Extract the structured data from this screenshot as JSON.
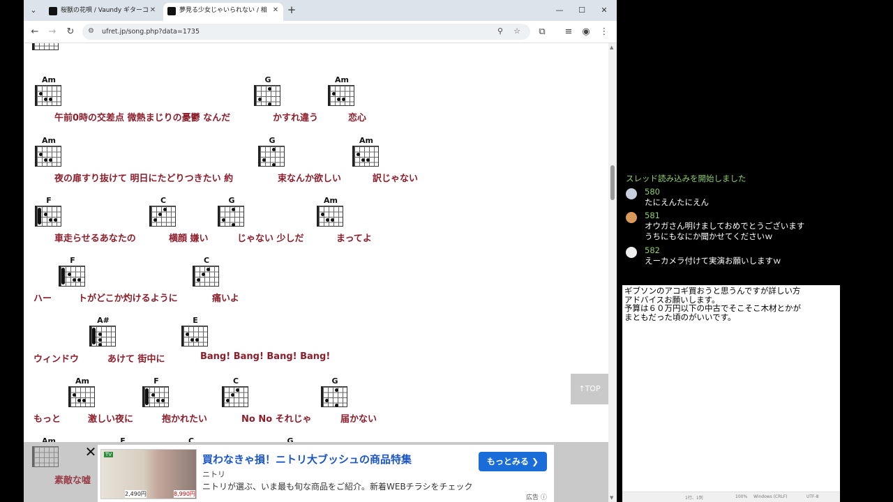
{
  "browser": {
    "tabs": [
      {
        "title": "桜獣の花唄 / Vaundy ギターコード/",
        "active": false
      },
      {
        "title": "夢見る少女じゃいられない / 相川七",
        "active": true
      }
    ],
    "url": "ufret.jp/song.php?data=1735"
  },
  "chart_rows": [
    {
      "chords": [
        {
          "name": "Am"
        },
        {
          "name": "G"
        },
        {
          "name": "Am"
        }
      ],
      "lyrics": [
        "午前0時の交差点 微熱まじりの憂鬱 なんだ",
        "かすれ違う",
        "恋心"
      ]
    },
    {
      "chords": [
        {
          "name": "Am"
        },
        {
          "name": "G"
        },
        {
          "name": "Am"
        }
      ],
      "lyrics": [
        "夜の扉すり抜けて 明日にたどりつきたい 約",
        "束なんか欲しい",
        "訳じゃない"
      ]
    },
    {
      "chords": [
        {
          "name": "F"
        },
        {
          "name": "C"
        },
        {
          "name": "G"
        },
        {
          "name": "Am"
        }
      ],
      "lyrics": [
        "車走らせるあなたの",
        "横顔 嫌い",
        "じゃない 少しだ",
        "まってよ"
      ]
    },
    {
      "chords": [
        {
          "name": "F"
        },
        {
          "name": "C"
        }
      ],
      "lyrics": [
        "ハー",
        "トがどこか灼けるように",
        "痛いよ"
      ]
    },
    {
      "chords": [
        {
          "name": "A#"
        },
        {
          "name": "E"
        }
      ],
      "lyrics": [
        "ウィンドウ",
        "あけて 街中に",
        "Bang! Bang! Bang! Bang!"
      ]
    },
    {
      "chords": [
        {
          "name": "Am"
        },
        {
          "name": "F"
        },
        {
          "name": "C"
        },
        {
          "name": "G"
        }
      ],
      "lyrics": [
        "もっと",
        "激しい夜に",
        "抱かれたい",
        "No No それじゃ",
        "届かない"
      ]
    },
    {
      "chords": [
        {
          "name": "Am"
        },
        {
          "name": "F"
        },
        {
          "name": "C"
        },
        {
          "name": "G"
        }
      ],
      "lyrics": [
        "素敵な嘘"
      ]
    }
  ],
  "top_button": "↑TOP",
  "ad": {
    "badge": "TV",
    "price1": "2,490円",
    "price2": "8,990円",
    "headline": "買わなきゃ損！ニトリ大ブッシュの商品特集",
    "brand": "ニトリ",
    "description": "ニトリが選ぶ、いま最も旬な商品をご紹介。新着WEBチラシをチェック",
    "cta": "もっとみる ❯",
    "label": "広告 ⓘ"
  },
  "comments": {
    "status": "スレッド読み込みを開始しました",
    "items": [
      {
        "num": "580",
        "text": "たにえんたにえん"
      },
      {
        "num": "581",
        "text": "オウガさん明けましておめでとうございます\nうちにもなにか聞かせてくださいｗ"
      },
      {
        "num": "582",
        "text": "えーカメラ付けて実演お願いしますｗ"
      }
    ]
  },
  "notepad": {
    "text": "ギブソンのアコギ買おうと思うんですが詳しい方\nアドバイスお願いします。\n予算は６０万円以下の中古でそこそこ木材とかが\nまともだった頃のがいいです。",
    "status": [
      "1行、1列",
      "100%",
      "Windows (CRLF)",
      "UTF-8"
    ]
  }
}
